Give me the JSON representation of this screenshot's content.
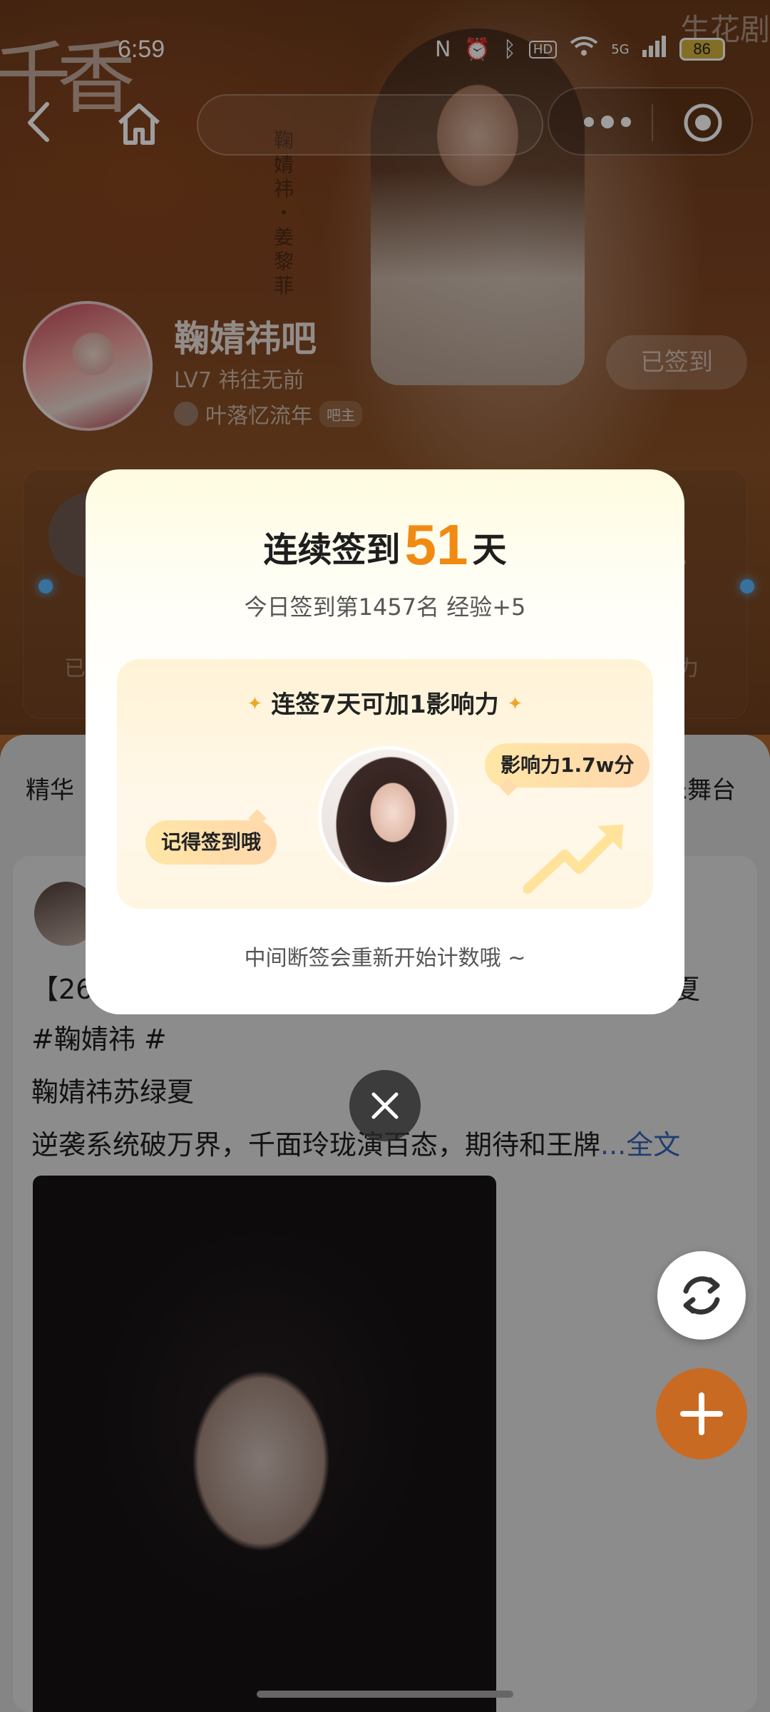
{
  "status_bar": {
    "time": "6:59",
    "battery": "86",
    "network": "5G",
    "hd": "HD"
  },
  "banner": {
    "brand_script": "千香",
    "watermark": "生花剧",
    "vertical_caption": "鞠婧祎 ・ 姜黎菲"
  },
  "forum": {
    "name": "鞠婧祎吧",
    "level": "LV7 祎往无前",
    "owner_name": "叶落忆流年",
    "owner_badge": "吧主",
    "signed_label": "已签到"
  },
  "stats_card": {
    "left_label": "已",
    "right_label": "力",
    "help_glyph": "?"
  },
  "tabs": {
    "left": "精华",
    "right": "乐舞台"
  },
  "post": {
    "line1": "【26",
    "line1_tail": "夏",
    "line2": "#鞠婧祎 #",
    "line3": "鞠婧祎苏绿夏",
    "line4": "逆袭系统破万界，千面玲珑演百态，期待和王牌",
    "more_label": "...全文"
  },
  "modal": {
    "title_prefix": "连续签到",
    "streak_days": "51",
    "title_suffix": "天",
    "subtitle": "今日签到第1457名 经验+5",
    "reward_title": "连签7天可加1影响力",
    "spark_glyph": "✦",
    "bubble_left": "记得签到哦",
    "bubble_right": "影响力1.7w分",
    "note": "中间断签会重新开始计数哦 ~"
  },
  "colors": {
    "accent_orange": "#f18a13",
    "fab_orange": "#c96a22",
    "link_blue": "#3d6fc9",
    "reward_panel": "#fff3d6"
  },
  "icons": {
    "back": "chevron-left-icon",
    "home": "home-icon",
    "more": "more-dots-icon",
    "target": "target-icon",
    "close": "close-icon",
    "refresh": "refresh-icon",
    "add": "plus-icon",
    "trend": "trend-arrow-icon"
  }
}
